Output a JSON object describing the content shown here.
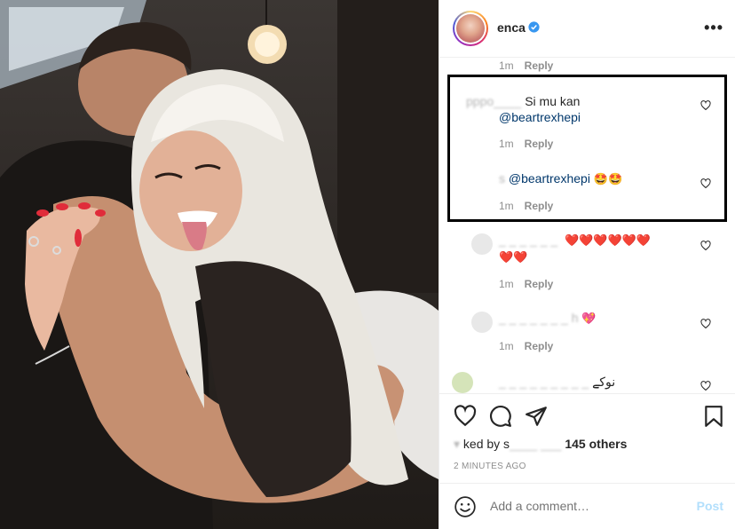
{
  "post": {
    "username": "enca",
    "more_icon": "more-horizontal-icon",
    "verified_icon": "verified-badge-icon"
  },
  "comments": {
    "top_meta": {
      "time": "1m",
      "reply": "Reply"
    },
    "items": [
      {
        "user": "pppo",
        "text": "Si mu kan",
        "mention": "@beartrexhepi",
        "time": "1m",
        "reply": "Reply"
      },
      {
        "user": "s",
        "text": "",
        "mention": "@beartrexhepi",
        "emoji": "🤩🤩",
        "time": "1m",
        "reply": "Reply"
      },
      {
        "user": "",
        "text": "",
        "emoji_line1": "❤️❤️❤️❤️❤️❤️",
        "emoji_line2": "❤️❤️",
        "time": "1m",
        "reply": "Reply"
      },
      {
        "user": "h",
        "text": "",
        "emoji": "💖",
        "time": "1m",
        "reply": "Reply"
      },
      {
        "user": "",
        "text": "نوکے"
      }
    ]
  },
  "actions": {
    "icons": [
      "heart-icon",
      "comment-icon",
      "share-icon",
      "bookmark-icon"
    ],
    "liked_by_prefix": "ked by s",
    "others": "145 others",
    "timestamp": "2 MINUTES AGO"
  },
  "comment_input": {
    "placeholder": "Add a comment…",
    "post_label": "Post"
  },
  "colors": {
    "accent": "#0095f6",
    "post_disabled": "#b2dffc",
    "mention": "#00376b",
    "heart": "#ed4956"
  }
}
